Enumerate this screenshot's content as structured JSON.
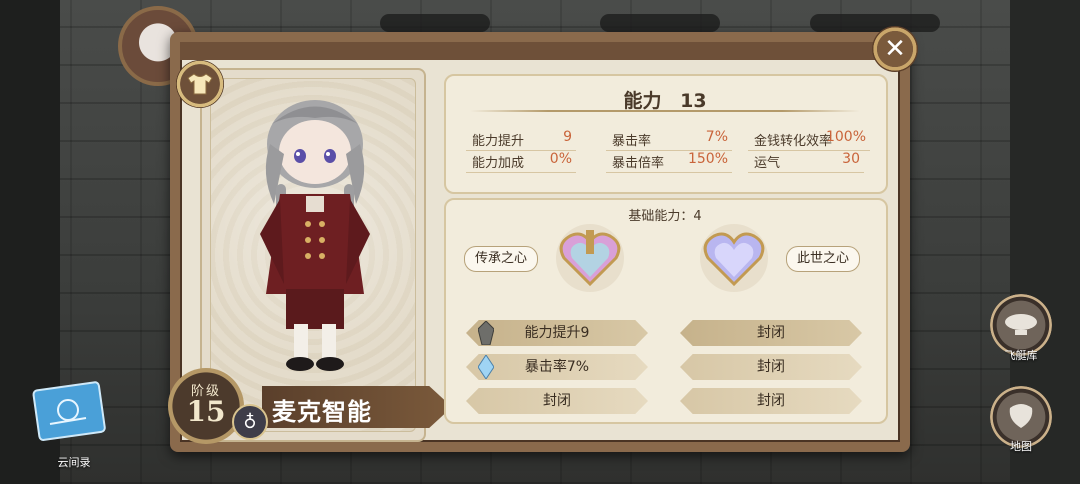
{
  "ability": {
    "title": "能力",
    "level": "13",
    "stats": [
      {
        "label": "能力提升",
        "value": "9"
      },
      {
        "label": "暴击率",
        "value": "7%"
      },
      {
        "label": "金钱转化效率",
        "value": "100%"
      },
      {
        "label": "能力加成",
        "value": "0%"
      },
      {
        "label": "暴击倍率",
        "value": "150%"
      },
      {
        "label": "运气",
        "value": "30"
      }
    ]
  },
  "base": {
    "title": "基础能力：4",
    "left_heart_label": "传承之心",
    "right_heart_label": "此世之心",
    "left_slots": [
      "能力提升9",
      "暴击率7%",
      "封闭"
    ],
    "right_slots": [
      "封闭",
      "封闭",
      "封闭"
    ]
  },
  "character": {
    "rank_label": "阶级",
    "rank_value": "15",
    "name": "麦克智能"
  },
  "side": {
    "airship_label": "飞艇库",
    "map_label": "地图",
    "book_label": "云间录"
  },
  "icons": {
    "close": "close-icon",
    "shirt": "shirt-icon",
    "ring": "ring-icon"
  }
}
